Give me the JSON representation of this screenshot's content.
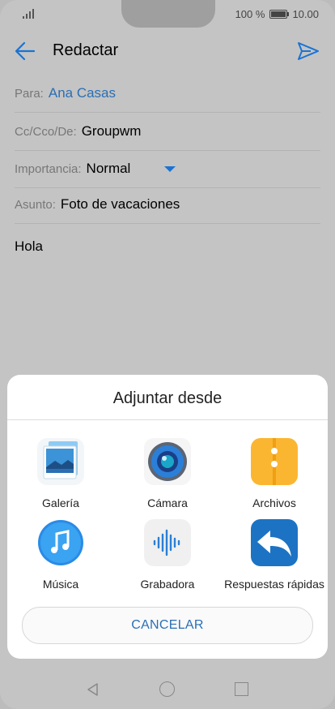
{
  "status_bar": {
    "battery_percent": "100 %",
    "time": "10.00"
  },
  "app_bar": {
    "title": "Redactar",
    "back_icon": "arrow-left-icon",
    "send_icon": "send-icon"
  },
  "fields": {
    "to": {
      "label": "Para:",
      "value": "Ana Casas"
    },
    "cc": {
      "label": "Cc/Cco/De:",
      "value": "Groupwm"
    },
    "importance": {
      "label": "Importancia:",
      "value": "Normal"
    },
    "subject": {
      "label": "Asunto:",
      "value": "Foto de vacaciones"
    }
  },
  "body": {
    "text": "Hola"
  },
  "attach_sheet": {
    "title": "Adjuntar desde",
    "options": [
      {
        "label": "Galería",
        "icon": "gallery-icon"
      },
      {
        "label": "Cámara",
        "icon": "camera-icon"
      },
      {
        "label": "Archivos",
        "icon": "files-icon"
      },
      {
        "label": "Música",
        "icon": "music-icon"
      },
      {
        "label": "Grabadora",
        "icon": "recorder-icon"
      },
      {
        "label": "Respuestas rápidas",
        "icon": "quick-replies-icon"
      }
    ],
    "cancel_label": "CANCELAR"
  },
  "colors": {
    "accent": "#1a73d3",
    "link": "#2a6fb5",
    "files": "#fbb631",
    "quick_replies": "#1c73c4",
    "music": "#2a8be6"
  }
}
